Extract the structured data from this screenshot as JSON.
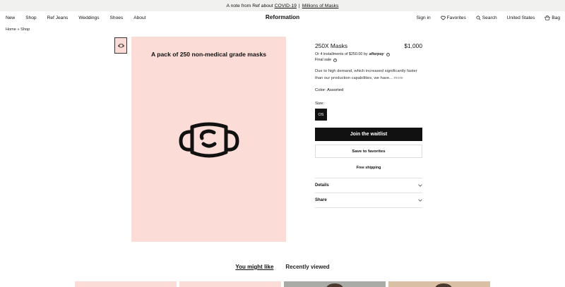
{
  "announcement": {
    "prefix": "A note from Ref about",
    "link1": "COVID-19",
    "separator": "|",
    "link2": "Millions of Masks"
  },
  "nav": {
    "left": [
      "New",
      "Shop",
      "Ref Jeans",
      "Weddings",
      "Shoes",
      "About"
    ],
    "brand": "Reformation",
    "sign_in": "Sign in",
    "favorites": "Favorites",
    "search": "Search",
    "region": "United States",
    "bag": "Bag"
  },
  "breadcrumb": "Home » Shop",
  "hero": {
    "title": "A pack of 250 non-medical grade masks",
    "icon": "face-mask-icon"
  },
  "product": {
    "name": "250X Masks",
    "price": "$1,000",
    "afterpay_text": "Or 4 installments of $250.00 by",
    "afterpay_brand": "afterpay",
    "final_sale": "Final sale",
    "description": "Due to high demand, which increased significantly faster than our production capabilities, we have...",
    "more": "more",
    "color_label": "Color: Assorted",
    "size_label": "Size:",
    "size_value": "OS",
    "waitlist_button": "Join the waitlist",
    "favorites_button": "Save to favorites",
    "shipping": "Free shipping",
    "details": "Details",
    "share": "Share"
  },
  "tabs": {
    "you_might_like": "You might like",
    "recently_viewed": "Recently viewed"
  },
  "colors": {
    "accent": "#111111",
    "hero_bg": "#fbdcd6",
    "announce_bg": "#f1f1ef"
  }
}
